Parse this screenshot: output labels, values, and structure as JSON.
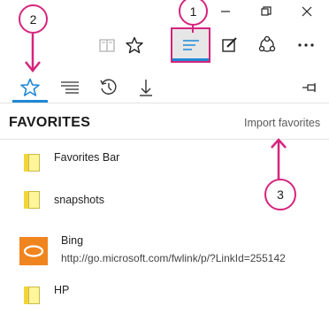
{
  "callouts": [
    "1",
    "2",
    "3"
  ],
  "hub": {
    "title": "FAVORITES",
    "import_label": "Import favorites"
  },
  "favorites": [
    {
      "label": "Favorites Bar",
      "icon": "folder-icon"
    },
    {
      "label": "snapshots",
      "icon": "folder-icon"
    },
    {
      "label": "Bing",
      "url": "http://go.microsoft.com/fwlink/p/?LinkId=255142",
      "icon": "bing-logo"
    },
    {
      "label": "HP",
      "icon": "folder-icon"
    }
  ],
  "colors": {
    "accent": "#1e88d6",
    "annotation": "#d6247d",
    "folder": "#fff59a",
    "bing": "#f0841e"
  }
}
